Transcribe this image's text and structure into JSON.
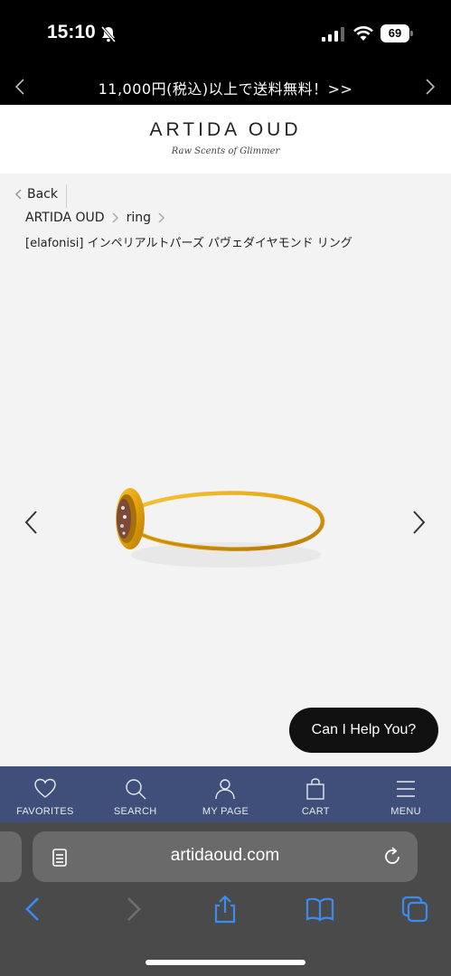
{
  "status_bar": {
    "time": "15:10",
    "battery": "69"
  },
  "promo": {
    "text": "11,000円(税込)以上で送料無料！>>"
  },
  "header": {
    "logo": "ARTIDA OUD",
    "tagline": "Raw Scents of Glimmer"
  },
  "breadcrumb": {
    "back_label": "Back",
    "items": [
      "ARTIDA OUD",
      "ring"
    ],
    "product_title": "[elafonisi] インペリアルトパーズ パヴェダイヤモンド リング"
  },
  "chat": {
    "label": "Can I Help You?"
  },
  "bottom_nav": {
    "items": [
      {
        "label": "FAVORITES",
        "icon": "heart-icon"
      },
      {
        "label": "SEARCH",
        "icon": "search-icon"
      },
      {
        "label": "MY PAGE",
        "icon": "user-icon"
      },
      {
        "label": "CART",
        "icon": "bag-icon"
      },
      {
        "label": "MENU",
        "icon": "menu-icon"
      }
    ]
  },
  "browser": {
    "url": "artidaoud.com"
  },
  "colors": {
    "nav_bg": "#3f4f7a",
    "ring_gold": "#e3a20f",
    "safari_blue": "#3b8bf0"
  }
}
